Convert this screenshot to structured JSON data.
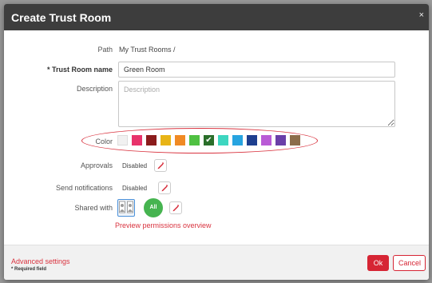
{
  "dialog": {
    "title": "Create Trust Room",
    "close_glyph": "×"
  },
  "form": {
    "path_label": "Path",
    "path_value": "My Trust Rooms /",
    "name_label": "* Trust Room name",
    "name_value": "Green Room",
    "description_label": "Description",
    "description_placeholder": "Description",
    "color_label": "Color",
    "colors": [
      "#f1f1f1",
      "#e8336b",
      "#8b1c1c",
      "#e8b416",
      "#f08a24",
      "#4fc142",
      "#2a6e2a",
      "#3dd6c0",
      "#27a4e0",
      "#1e3f8f",
      "#b95bd6",
      "#6a3fa8",
      "#8c6c4a"
    ],
    "selected_color_index": 6,
    "approvals_label": "Approvals",
    "approvals_value": "Disabled",
    "notifications_label": "Send notifications",
    "notifications_value": "Disabled",
    "shared_label": "Shared with",
    "all_label": "All",
    "preview_link": "Preview permissions overview"
  },
  "footer": {
    "advanced_link": "Advanced settings",
    "required_note": "* Required field",
    "ok_label": "Ok",
    "cancel_label": "Cancel"
  },
  "icons": {
    "close": "close-icon",
    "edit": "pencil-icon",
    "users": "users-icon",
    "check": "check-icon"
  }
}
